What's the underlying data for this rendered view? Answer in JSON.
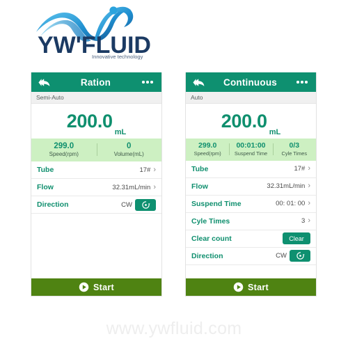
{
  "logo": {
    "brand": "YW'FLUID",
    "tagline": "Innovative technology",
    "mark_icon": "water-swoosh-icon",
    "brand_color": "#1b3a63",
    "wave_color": "#2196d9"
  },
  "panels": [
    {
      "id": "ration",
      "header": {
        "back_icon": "double-chevron-left-icon",
        "title": "Ration",
        "menu_icon": "more-dots-icon"
      },
      "submode": "Semi-Auto",
      "big_value": {
        "number": "200.0",
        "unit": "mL"
      },
      "stats": [
        {
          "value": "299.0",
          "label": "Speed(rpm)"
        },
        {
          "value": "0",
          "label": "Volume(mL)"
        }
      ],
      "rows": [
        {
          "label": "Tube",
          "value": "17#",
          "control": "chevron"
        },
        {
          "label": "Flow",
          "value": "32.31mL/min",
          "control": "chevron"
        },
        {
          "label": "Direction",
          "value": "CW",
          "control": "rotate-button",
          "button_icon": "clockwise-rotation-icon"
        }
      ],
      "start": {
        "label": "Start",
        "icon": "play-circle-icon"
      }
    },
    {
      "id": "continuous",
      "header": {
        "back_icon": "double-chevron-left-icon",
        "title": "Continuous",
        "menu_icon": "more-dots-icon"
      },
      "submode": "Auto",
      "big_value": {
        "number": "200.0",
        "unit": "mL"
      },
      "stats": [
        {
          "value": "299.0",
          "label": "Speed(rpm)"
        },
        {
          "value": "00:01:00",
          "label": "Suspend Time"
        },
        {
          "value": "0/3",
          "label": "Cyle Times"
        }
      ],
      "rows": [
        {
          "label": "Tube",
          "value": "17#",
          "control": "chevron"
        },
        {
          "label": "Flow",
          "value": "32.31mL/min",
          "control": "chevron"
        },
        {
          "label": "Suspend Time",
          "value": "00: 01: 00",
          "control": "chevron"
        },
        {
          "label": "Cyle Times",
          "value": "3",
          "control": "chevron"
        },
        {
          "label": "Clear count",
          "value": "",
          "control": "clear-button",
          "button_label": "Clear"
        },
        {
          "label": "Direction",
          "value": "CW",
          "control": "rotate-button",
          "button_icon": "clockwise-rotation-icon"
        }
      ],
      "start": {
        "label": "Start",
        "icon": "play-circle-icon"
      }
    }
  ],
  "watermark": "www.ywfluid.com",
  "colors": {
    "header_green": "#0e9070",
    "accent_green": "#0f8f6e",
    "stats_band": "#cdf0c2",
    "start_olive": "#4f8312",
    "submode_gray": "#f0f0f0"
  }
}
